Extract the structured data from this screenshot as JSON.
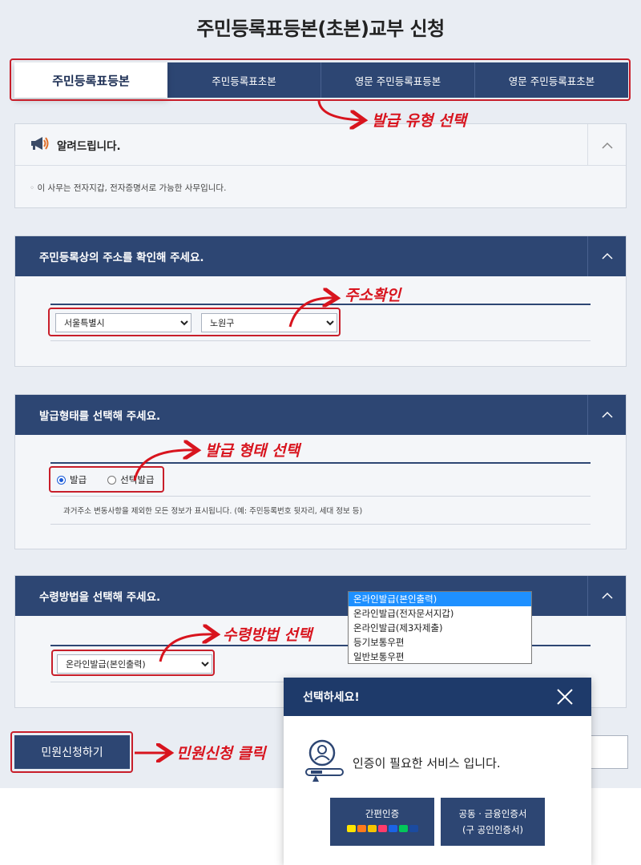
{
  "page_title": "주민등록표등본(초본)교부 신청",
  "tabs": [
    {
      "label": "주민등록표등본",
      "active": true
    },
    {
      "label": "주민등록표초본",
      "active": false
    },
    {
      "label": "영문 주민등록표등본",
      "active": false
    },
    {
      "label": "영문 주민등록표초본",
      "active": false
    }
  ],
  "notice": {
    "title": "알려드립니다.",
    "text": "이 사무는 전자지갑, 전자증명서로 가능한 사무입니다."
  },
  "address_section": {
    "title": "주민등록상의 주소를 확인해 주세요.",
    "city": "서울특별시",
    "district": "노원구"
  },
  "issue_type_section": {
    "title": "발급형태를 선택해 주세요.",
    "options": [
      "발급",
      "선택발급"
    ],
    "selected": "발급",
    "help": "과거주소 변동사항을 제외한 모든 정보가 표시됩니다. (예: 주민등록번호 뒷자리, 세대 정보 등)"
  },
  "receive_section": {
    "title": "수령방법을 선택해 주세요.",
    "selected": "온라인발급(본인출력)",
    "options": [
      "온라인발급(본인출력)",
      "온라인발급(전자문서지갑)",
      "온라인발급(제3자제출)",
      "등기보통우편",
      "일반보통우편"
    ]
  },
  "apply_button": "민원신청하기",
  "modal": {
    "title": "선택하세요!",
    "message": "인증이 필요한 서비스 입니다.",
    "btn_simple": "간편인증",
    "btn_cert_line1": "공동 · 금융인증서",
    "btn_cert_line2": "(구 공인인증서)"
  },
  "annotations": {
    "tab_select": "발급 유형 선택",
    "address_check": "주소확인",
    "issue_type_select": "발급 형태 선택",
    "receive_select": "수령방법 선택",
    "apply_click": "민원신청 클릭"
  },
  "colors": {
    "navy": "#2d4673",
    "modal_header": "#1e3a6a",
    "annotation_red": "#d8141e"
  }
}
